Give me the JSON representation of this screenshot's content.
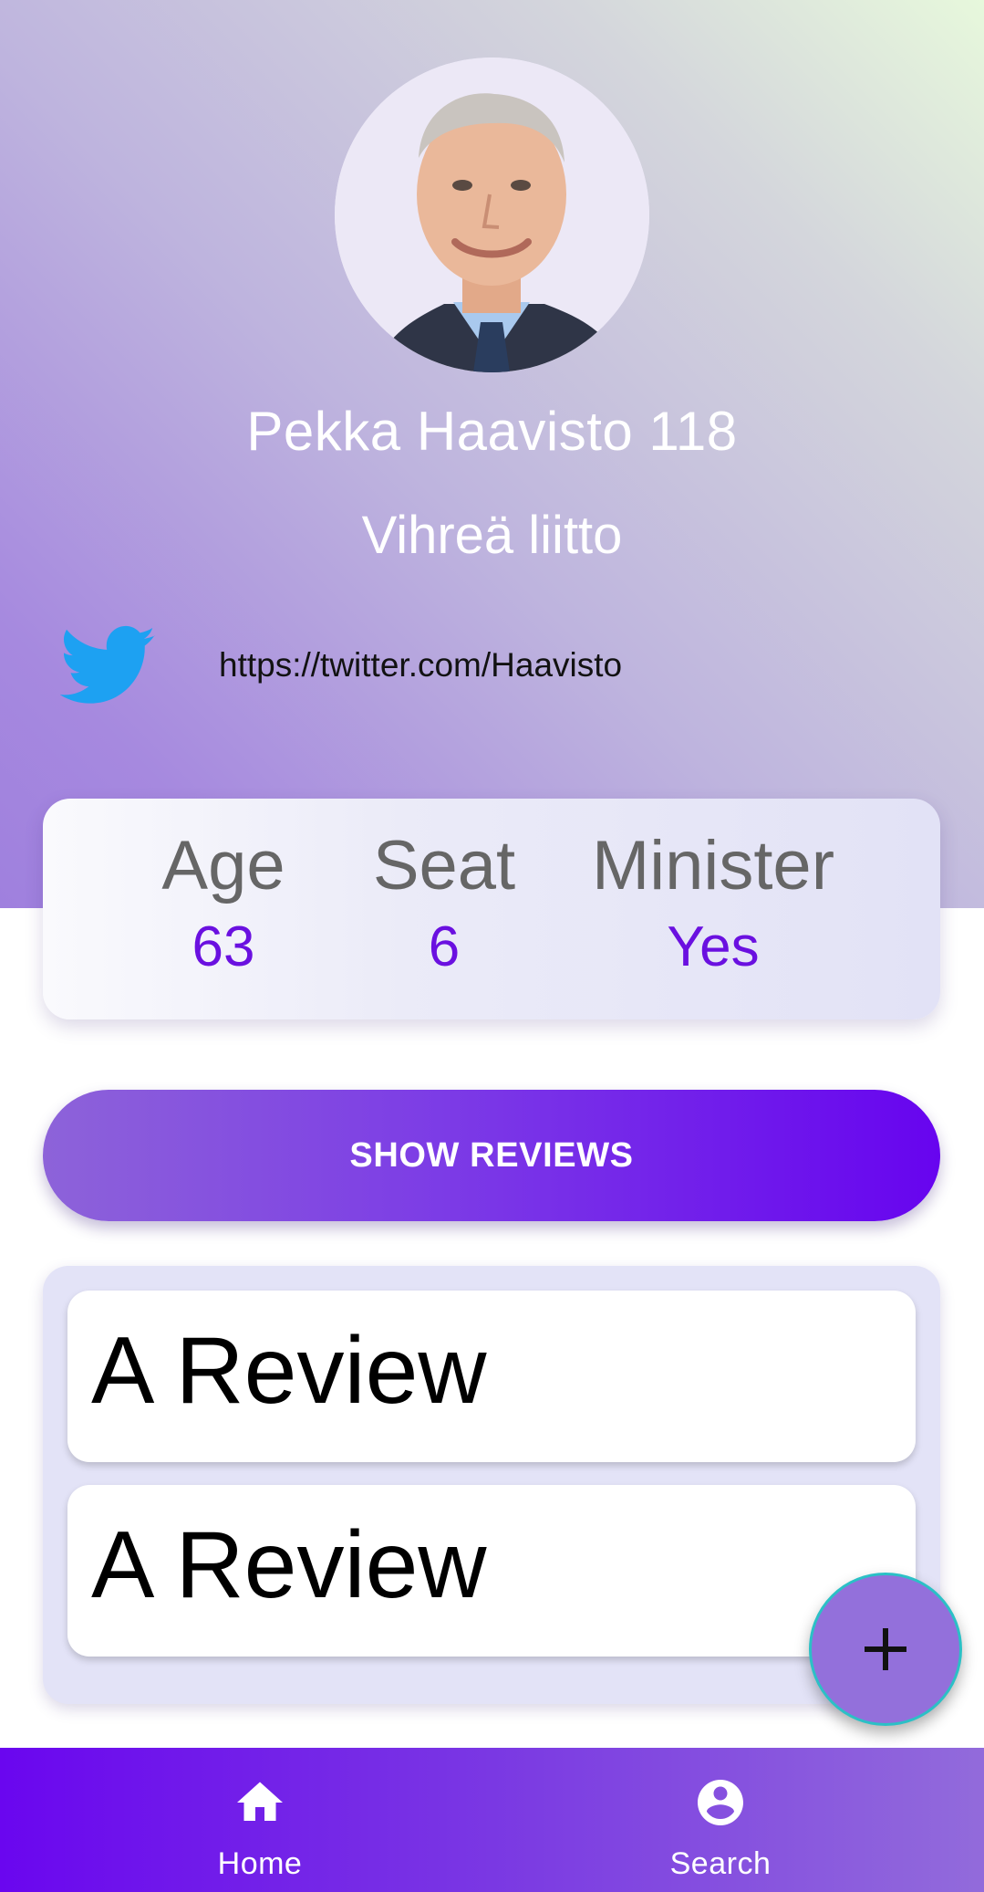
{
  "profile": {
    "name": "Pekka Haavisto 118",
    "party": "Vihreä liitto",
    "twitter_url": "https://twitter.com/Haavisto",
    "avatar_icon": "portrait-photo"
  },
  "stats": {
    "age_label": "Age",
    "age_value": "63",
    "seat_label": "Seat",
    "seat_value": "6",
    "minister_label": "Minister",
    "minister_value": "Yes"
  },
  "actions": {
    "show_reviews_label": "SHOW REVIEWS",
    "add_icon": "plus-icon"
  },
  "reviews": [
    {
      "title": "A Review"
    },
    {
      "title": "A Review"
    }
  ],
  "nav": {
    "home_label": "Home",
    "search_label": "Search",
    "home_icon": "home-icon",
    "search_icon": "account-circle-icon"
  },
  "colors": {
    "accent": "#6a10e0",
    "fab": "#9370db",
    "twitter": "#1da1f2"
  }
}
